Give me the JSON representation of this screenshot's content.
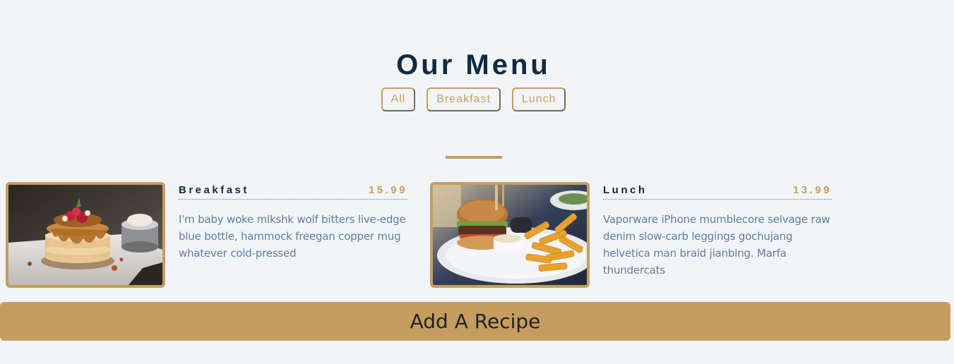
{
  "section": {
    "title": "Our Menu"
  },
  "filters": [
    "All",
    "Breakfast",
    "Lunch"
  ],
  "items": [
    {
      "name": "Breakfast",
      "price": "15.99",
      "description": "I'm baby woke mlkshk wolf bitters live-edge blue bottle, hammock freegan copper mug whatever cold-pressed",
      "image": "pancake-stack"
    },
    {
      "name": "Lunch",
      "price": "13.99",
      "description": "Vaporware iPhone mumblecore selvage raw denim slow-carb leggings gochujang helvetica man braid jianbing. Marfa thundercats",
      "image": "burger-and-fries"
    }
  ],
  "actions": {
    "add_recipe": "Add A Recipe"
  },
  "colors": {
    "accent": "#c59d5f",
    "heading": "#102a42",
    "text": "#617d98",
    "background": "#f1f5f8"
  }
}
